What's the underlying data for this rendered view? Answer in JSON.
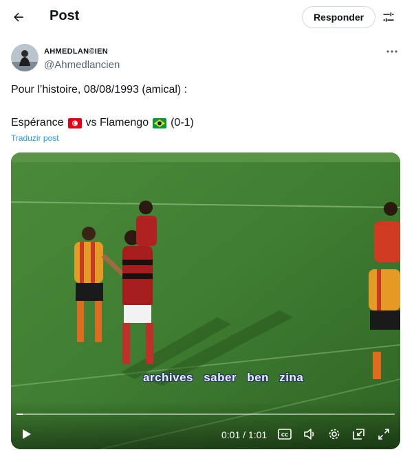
{
  "header": {
    "title": "Post",
    "reply_label": "Responder"
  },
  "author": {
    "display_name": "AHMEDLAN©IEN",
    "handle": "@Ahmedlancien"
  },
  "tweet": {
    "line1": "Pour l’histoire, 08/08/1993 (amical) :",
    "team_home": "Espérance",
    "team_vs": "vs Flamengo",
    "score": "(0-1)",
    "flag_home": "tunisia-flag",
    "flag_away": "brazil-flag",
    "translate_label": "Traduzir post"
  },
  "video": {
    "watermark": "archives saber ben zina",
    "time_display": "0:01 / 1:01",
    "progress": 0.016
  },
  "colors": {
    "accent": "#1d9bf0",
    "pitch": "#3d7a2e",
    "esperance_red": "#d0332a",
    "esperance_yellow": "#e9a520"
  }
}
